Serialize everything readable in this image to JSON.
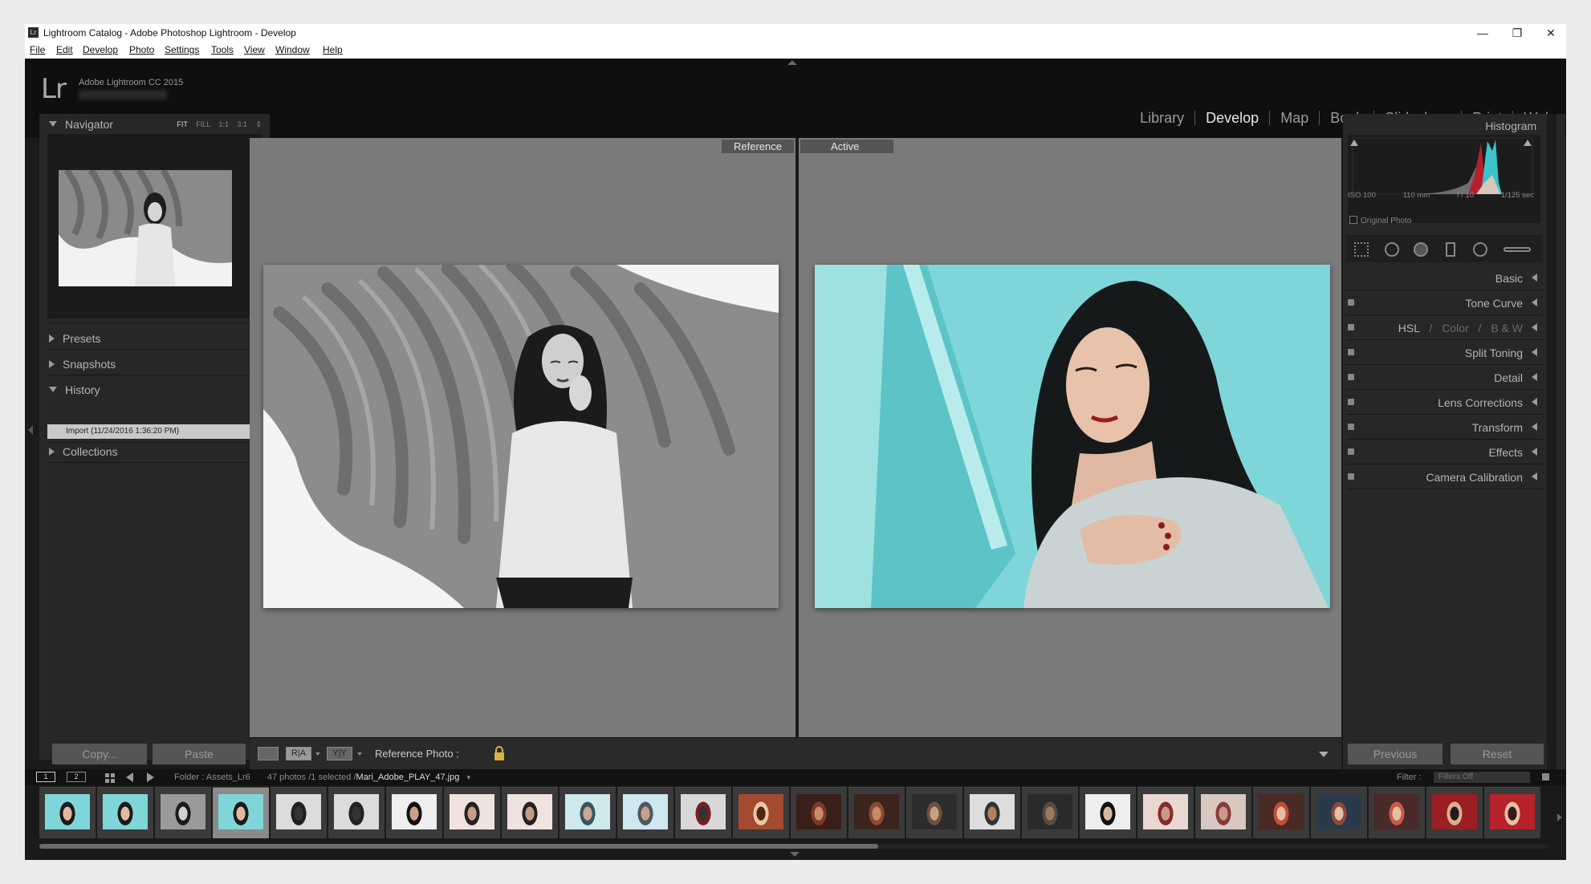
{
  "window": {
    "title": "Lightroom Catalog - Adobe Photoshop Lightroom - Develop",
    "app_icon": "Lr",
    "controls": [
      "—",
      "❐",
      "✕"
    ]
  },
  "menu": [
    "File",
    "Edit",
    "Develop",
    "Photo",
    "Settings",
    "Tools",
    "View",
    "Window",
    "Help"
  ],
  "identity": {
    "logo": "Lr",
    "product": "Adobe Lightroom CC 2015"
  },
  "modules": [
    "Library",
    "Develop",
    "Map",
    "Book",
    "Slideshow",
    "Print",
    "Web"
  ],
  "active_module": "Develop",
  "left_panel": {
    "navigator": {
      "label": "Navigator",
      "zoom": [
        "FIT",
        "FILL",
        "1:1",
        "3:1"
      ]
    },
    "presets": "Presets",
    "snapshots": "Snapshots",
    "history": {
      "label": "History",
      "items": [
        "Import (11/24/2016 1:36:20 PM)"
      ]
    },
    "collections": "Collections",
    "copy_btn": "Copy...",
    "paste_btn": "Paste"
  },
  "compare": {
    "reference_tag": "Reference",
    "active_tag": "Active"
  },
  "toolbar": {
    "ra": "R|A",
    "yy": "Y|Y",
    "ref_photo_label": "Reference Photo :"
  },
  "right_panel": {
    "histogram": {
      "label": "Histogram",
      "iso": "ISO 100",
      "focal": "110 mm",
      "aperture": "f / 10",
      "shutter": "1/125 sec",
      "original_photo": "Original Photo"
    },
    "sections": [
      "Basic",
      "Tone Curve",
      "HSL / Color / B&W",
      "Split Toning",
      "Detail",
      "Lens Corrections",
      "Transform",
      "Effects",
      "Camera Calibration"
    ],
    "hsl_parts": [
      "HSL",
      "/",
      "Color",
      "/",
      "B & W"
    ],
    "previous_btn": "Previous",
    "reset_btn": "Reset"
  },
  "filmstrip": {
    "monitors": [
      "1",
      "2"
    ],
    "folder": "Folder : Assets_Lr6",
    "count": "47 photos /1 selected /",
    "file": "Mari_Adobe_PLAY_47.jpg",
    "filter_label": "Filter :",
    "filter_value": "Filters Off",
    "selected_index": 3
  },
  "colors": {
    "accent_teal": "#7fd6d8",
    "panel": "#272727",
    "compare_bg": "#7a7a7a"
  }
}
